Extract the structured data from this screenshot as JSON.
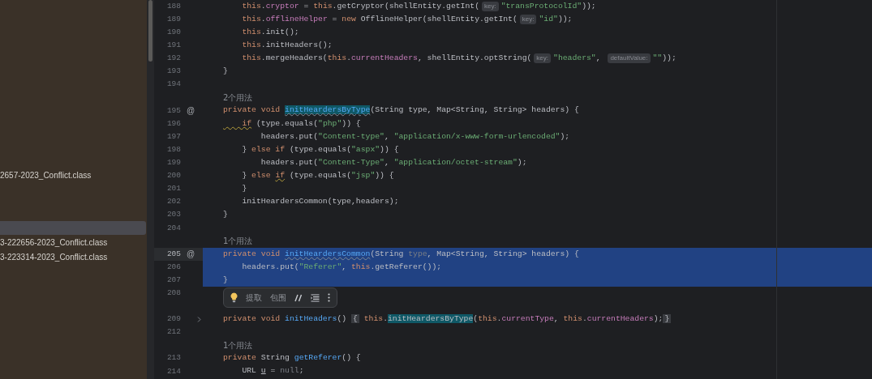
{
  "sidebar": {
    "items": [
      {
        "label": "2657-2023_Conflict.class",
        "selected": false
      },
      {
        "selected": true
      },
      {
        "label": "3-222656-2023_Conflict.class",
        "selected": false
      },
      {
        "label": "3-223314-2023_Conflict.class",
        "selected": false
      }
    ]
  },
  "editor": {
    "rows": [
      {
        "kind": "code",
        "number": "188",
        "selected": false,
        "folded": false,
        "tokens": [
          {
            "kind": "keyword",
            "text": "    this"
          },
          {
            "kind": "plain",
            "text": "."
          },
          {
            "kind": "field",
            "text": "cryptor"
          },
          {
            "kind": "plain",
            "text": " = "
          },
          {
            "kind": "keyword",
            "text": "this"
          },
          {
            "kind": "plain",
            "text": ".getCryptor(shellEntity.getInt("
          },
          {
            "kind": "hint",
            "text": "key:"
          },
          {
            "kind": "string",
            "text": "\"transProtocolId\""
          },
          {
            "kind": "plain",
            "text": "));"
          }
        ]
      },
      {
        "kind": "code",
        "number": "189",
        "selected": false,
        "folded": false,
        "tokens": [
          {
            "kind": "keyword",
            "text": "    this"
          },
          {
            "kind": "plain",
            "text": "."
          },
          {
            "kind": "field",
            "text": "offlineHelper"
          },
          {
            "kind": "plain",
            "text": " = "
          },
          {
            "kind": "keyword",
            "text": "new"
          },
          {
            "kind": "plain",
            "text": " OfflineHelper(shellEntity.getInt("
          },
          {
            "kind": "hint",
            "text": "key:"
          },
          {
            "kind": "string",
            "text": "\"id\""
          },
          {
            "kind": "plain",
            "text": "));"
          }
        ]
      },
      {
        "kind": "code",
        "number": "190",
        "selected": false,
        "folded": false,
        "tokens": [
          {
            "kind": "keyword",
            "text": "    this"
          },
          {
            "kind": "plain",
            "text": ".init();"
          }
        ]
      },
      {
        "kind": "code",
        "number": "191",
        "selected": false,
        "folded": false,
        "tokens": [
          {
            "kind": "keyword",
            "text": "    this"
          },
          {
            "kind": "plain",
            "text": ".initHeaders();"
          }
        ]
      },
      {
        "kind": "code",
        "number": "192",
        "selected": false,
        "folded": false,
        "tokens": [
          {
            "kind": "keyword",
            "text": "    this"
          },
          {
            "kind": "plain",
            "text": ".mergeHeaders("
          },
          {
            "kind": "keyword",
            "text": "this"
          },
          {
            "kind": "plain",
            "text": "."
          },
          {
            "kind": "field",
            "text": "currentHeaders"
          },
          {
            "kind": "plain",
            "text": ", shellEntity.optString("
          },
          {
            "kind": "hint",
            "text": "key:"
          },
          {
            "kind": "string",
            "text": "\"headers\""
          },
          {
            "kind": "plain",
            "text": ", "
          },
          {
            "kind": "hint",
            "text": "defaultValue:"
          },
          {
            "kind": "string",
            "text": "\"\""
          },
          {
            "kind": "plain",
            "text": "));"
          }
        ]
      },
      {
        "kind": "code",
        "number": "193",
        "selected": false,
        "folded": false,
        "tokens": [
          {
            "kind": "plain",
            "text": "}"
          }
        ]
      },
      {
        "kind": "code",
        "number": "194",
        "selected": false,
        "folded": false,
        "tokens": []
      },
      {
        "kind": "usage",
        "text": "2个用法",
        "selected": false
      },
      {
        "kind": "code",
        "number": "195",
        "gutter_mark": "@",
        "selected": false,
        "folded": false,
        "tokens": [
          {
            "kind": "keyword",
            "text": "private void "
          },
          {
            "kind": "match-flagged",
            "text": "initHeardersByType"
          },
          {
            "kind": "plain",
            "text": "(String type, Map<String, String> headers) {"
          }
        ]
      },
      {
        "kind": "code",
        "number": "196",
        "selected": false,
        "folded": false,
        "tokens": [
          {
            "kind": "keyword-flagged",
            "text": "    if"
          },
          {
            "kind": "plain",
            "text": " (type.equals("
          },
          {
            "kind": "string",
            "text": "\"php\""
          },
          {
            "kind": "plain",
            "text": ")) {"
          }
        ]
      },
      {
        "kind": "code",
        "number": "197",
        "selected": false,
        "folded": false,
        "tokens": [
          {
            "kind": "plain",
            "text": "        headers.put("
          },
          {
            "kind": "string",
            "text": "\"Content-type\""
          },
          {
            "kind": "plain",
            "text": ", "
          },
          {
            "kind": "string",
            "text": "\"application/x-www-form-urlencoded\""
          },
          {
            "kind": "plain",
            "text": ");"
          }
        ]
      },
      {
        "kind": "code",
        "number": "198",
        "selected": false,
        "folded": false,
        "tokens": [
          {
            "kind": "plain",
            "text": "    } "
          },
          {
            "kind": "keyword",
            "text": "else if"
          },
          {
            "kind": "plain",
            "text": " (type.equals("
          },
          {
            "kind": "string",
            "text": "\"aspx\""
          },
          {
            "kind": "plain",
            "text": ")) {"
          }
        ]
      },
      {
        "kind": "code",
        "number": "199",
        "selected": false,
        "folded": false,
        "tokens": [
          {
            "kind": "plain",
            "text": "        headers.put("
          },
          {
            "kind": "string",
            "text": "\"Content-Type\""
          },
          {
            "kind": "plain",
            "text": ", "
          },
          {
            "kind": "string",
            "text": "\"application/octet-stream\""
          },
          {
            "kind": "plain",
            "text": ");"
          }
        ]
      },
      {
        "kind": "code",
        "number": "200",
        "selected": false,
        "folded": false,
        "tokens": [
          {
            "kind": "plain",
            "text": "    } "
          },
          {
            "kind": "keyword",
            "text": "else "
          },
          {
            "kind": "keyword-flagged",
            "text": "if"
          },
          {
            "kind": "plain",
            "text": " (type.equals("
          },
          {
            "kind": "string",
            "text": "\"jsp\""
          },
          {
            "kind": "plain",
            "text": ")) {"
          }
        ]
      },
      {
        "kind": "code",
        "number": "201",
        "selected": false,
        "folded": false,
        "tokens": [
          {
            "kind": "plain",
            "text": "    }"
          }
        ]
      },
      {
        "kind": "code",
        "number": "202",
        "selected": false,
        "folded": false,
        "tokens": [
          {
            "kind": "plain",
            "text": "    initHeardersCommon(type,headers);"
          }
        ]
      },
      {
        "kind": "code",
        "number": "203",
        "selected": false,
        "folded": false,
        "tokens": [
          {
            "kind": "plain",
            "text": "}"
          }
        ]
      },
      {
        "kind": "code",
        "number": "204",
        "selected": false,
        "folded": false,
        "tokens": []
      },
      {
        "kind": "usage",
        "text": "1个用法",
        "selected": false
      },
      {
        "kind": "code",
        "number": "205",
        "gutter_mark": "@",
        "selected": true,
        "folded": false,
        "tokens": [
          {
            "kind": "keyword",
            "text": "private void "
          },
          {
            "kind": "method-flagged",
            "text": "initHeardersCommon"
          },
          {
            "kind": "plain",
            "text": "(String "
          },
          {
            "kind": "dim",
            "text": "type"
          },
          {
            "kind": "plain",
            "text": ", Map<String, String> headers) {"
          }
        ]
      },
      {
        "kind": "code",
        "number": "206",
        "selected": true,
        "folded": false,
        "tokens": [
          {
            "kind": "plain",
            "text": "    headers.put("
          },
          {
            "kind": "string",
            "text": "\"Referer\""
          },
          {
            "kind": "plain",
            "text": ", "
          },
          {
            "kind": "keyword",
            "text": "this"
          },
          {
            "kind": "plain",
            "text": ".getReferer());"
          }
        ]
      },
      {
        "kind": "code",
        "number": "207",
        "selected": true,
        "folded": false,
        "tokens": [
          {
            "kind": "plain",
            "text": "}"
          }
        ]
      },
      {
        "kind": "code",
        "number": "208",
        "selected": false,
        "folded": false,
        "tokens": []
      },
      {
        "kind": "blank",
        "selected": false
      },
      {
        "kind": "code",
        "number": "209",
        "selected": false,
        "folded": true,
        "tokens": [
          {
            "kind": "keyword",
            "text": "private void "
          },
          {
            "kind": "method",
            "text": "initHeaders"
          },
          {
            "kind": "plain",
            "text": "() "
          },
          {
            "kind": "fold",
            "text": "{"
          },
          {
            "kind": "keyword",
            "text": " this"
          },
          {
            "kind": "plain",
            "text": "."
          },
          {
            "kind": "match",
            "text": "initHeardersByType"
          },
          {
            "kind": "plain",
            "text": "("
          },
          {
            "kind": "keyword",
            "text": "this"
          },
          {
            "kind": "plain",
            "text": "."
          },
          {
            "kind": "field",
            "text": "currentType"
          },
          {
            "kind": "plain",
            "text": ", "
          },
          {
            "kind": "keyword",
            "text": "this"
          },
          {
            "kind": "plain",
            "text": "."
          },
          {
            "kind": "field",
            "text": "currentHeaders"
          },
          {
            "kind": "plain",
            "text": ");"
          },
          {
            "kind": "fold",
            "text": "}"
          }
        ]
      },
      {
        "kind": "code",
        "number": "212",
        "selected": false,
        "folded": false,
        "tokens": []
      },
      {
        "kind": "usage",
        "text": "1个用法",
        "selected": false
      },
      {
        "kind": "code",
        "number": "213",
        "selected": false,
        "folded": false,
        "tokens": [
          {
            "kind": "keyword",
            "text": "private"
          },
          {
            "kind": "plain",
            "text": " String "
          },
          {
            "kind": "method",
            "text": "getReferer"
          },
          {
            "kind": "plain",
            "text": "() {"
          }
        ]
      },
      {
        "kind": "code",
        "number": "214",
        "selected": false,
        "folded": false,
        "tokens": [
          {
            "kind": "plain",
            "text": "    URL "
          },
          {
            "kind": "underlined",
            "text": "u"
          },
          {
            "kind": "plain",
            "text": " = "
          },
          {
            "kind": "dim",
            "text": "null"
          },
          {
            "kind": "plain",
            "text": ";"
          }
        ]
      }
    ]
  },
  "popup": {
    "actions": [
      {
        "kind": "bulb"
      },
      {
        "kind": "text",
        "label": "提取"
      },
      {
        "kind": "text",
        "label": "包围"
      },
      {
        "kind": "comment"
      },
      {
        "kind": "format"
      },
      {
        "kind": "more"
      }
    ]
  }
}
